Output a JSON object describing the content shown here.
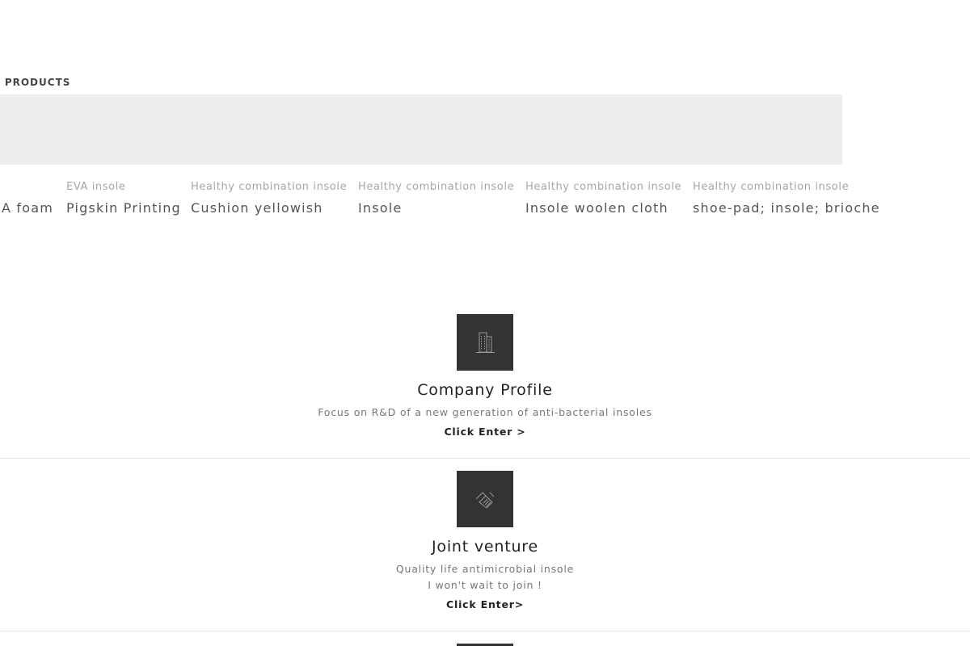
{
  "products_section": {
    "title": "L PRODUCTS",
    "items": [
      {
        "category": "",
        "name": "A foam"
      },
      {
        "category": "EVA insole",
        "name": "Pigskin Printing"
      },
      {
        "category": "Healthy combination insole",
        "name": "Cushion yellowish"
      },
      {
        "category": "Healthy combination insole",
        "name": "Insole"
      },
      {
        "category": "Healthy combination insole",
        "name": "Insole woolen cloth"
      },
      {
        "category": "Healthy combination insole",
        "name": "shoe-pad; insole; brioche"
      }
    ]
  },
  "company_profile": {
    "icon": "building-icon",
    "title": "Company Profile",
    "description": "Focus on R&D of a new generation of anti-bacterial insoles",
    "link": "Click Enter >"
  },
  "joint_venture": {
    "icon": "handshake-icon",
    "title": "Joint venture",
    "description_1": "Quality life antimicrobial insole",
    "description_2": "I won't wait to join !",
    "link": "Click Enter>"
  },
  "colors": {
    "tile_background": "#333333",
    "banner_background": "#ededed"
  }
}
